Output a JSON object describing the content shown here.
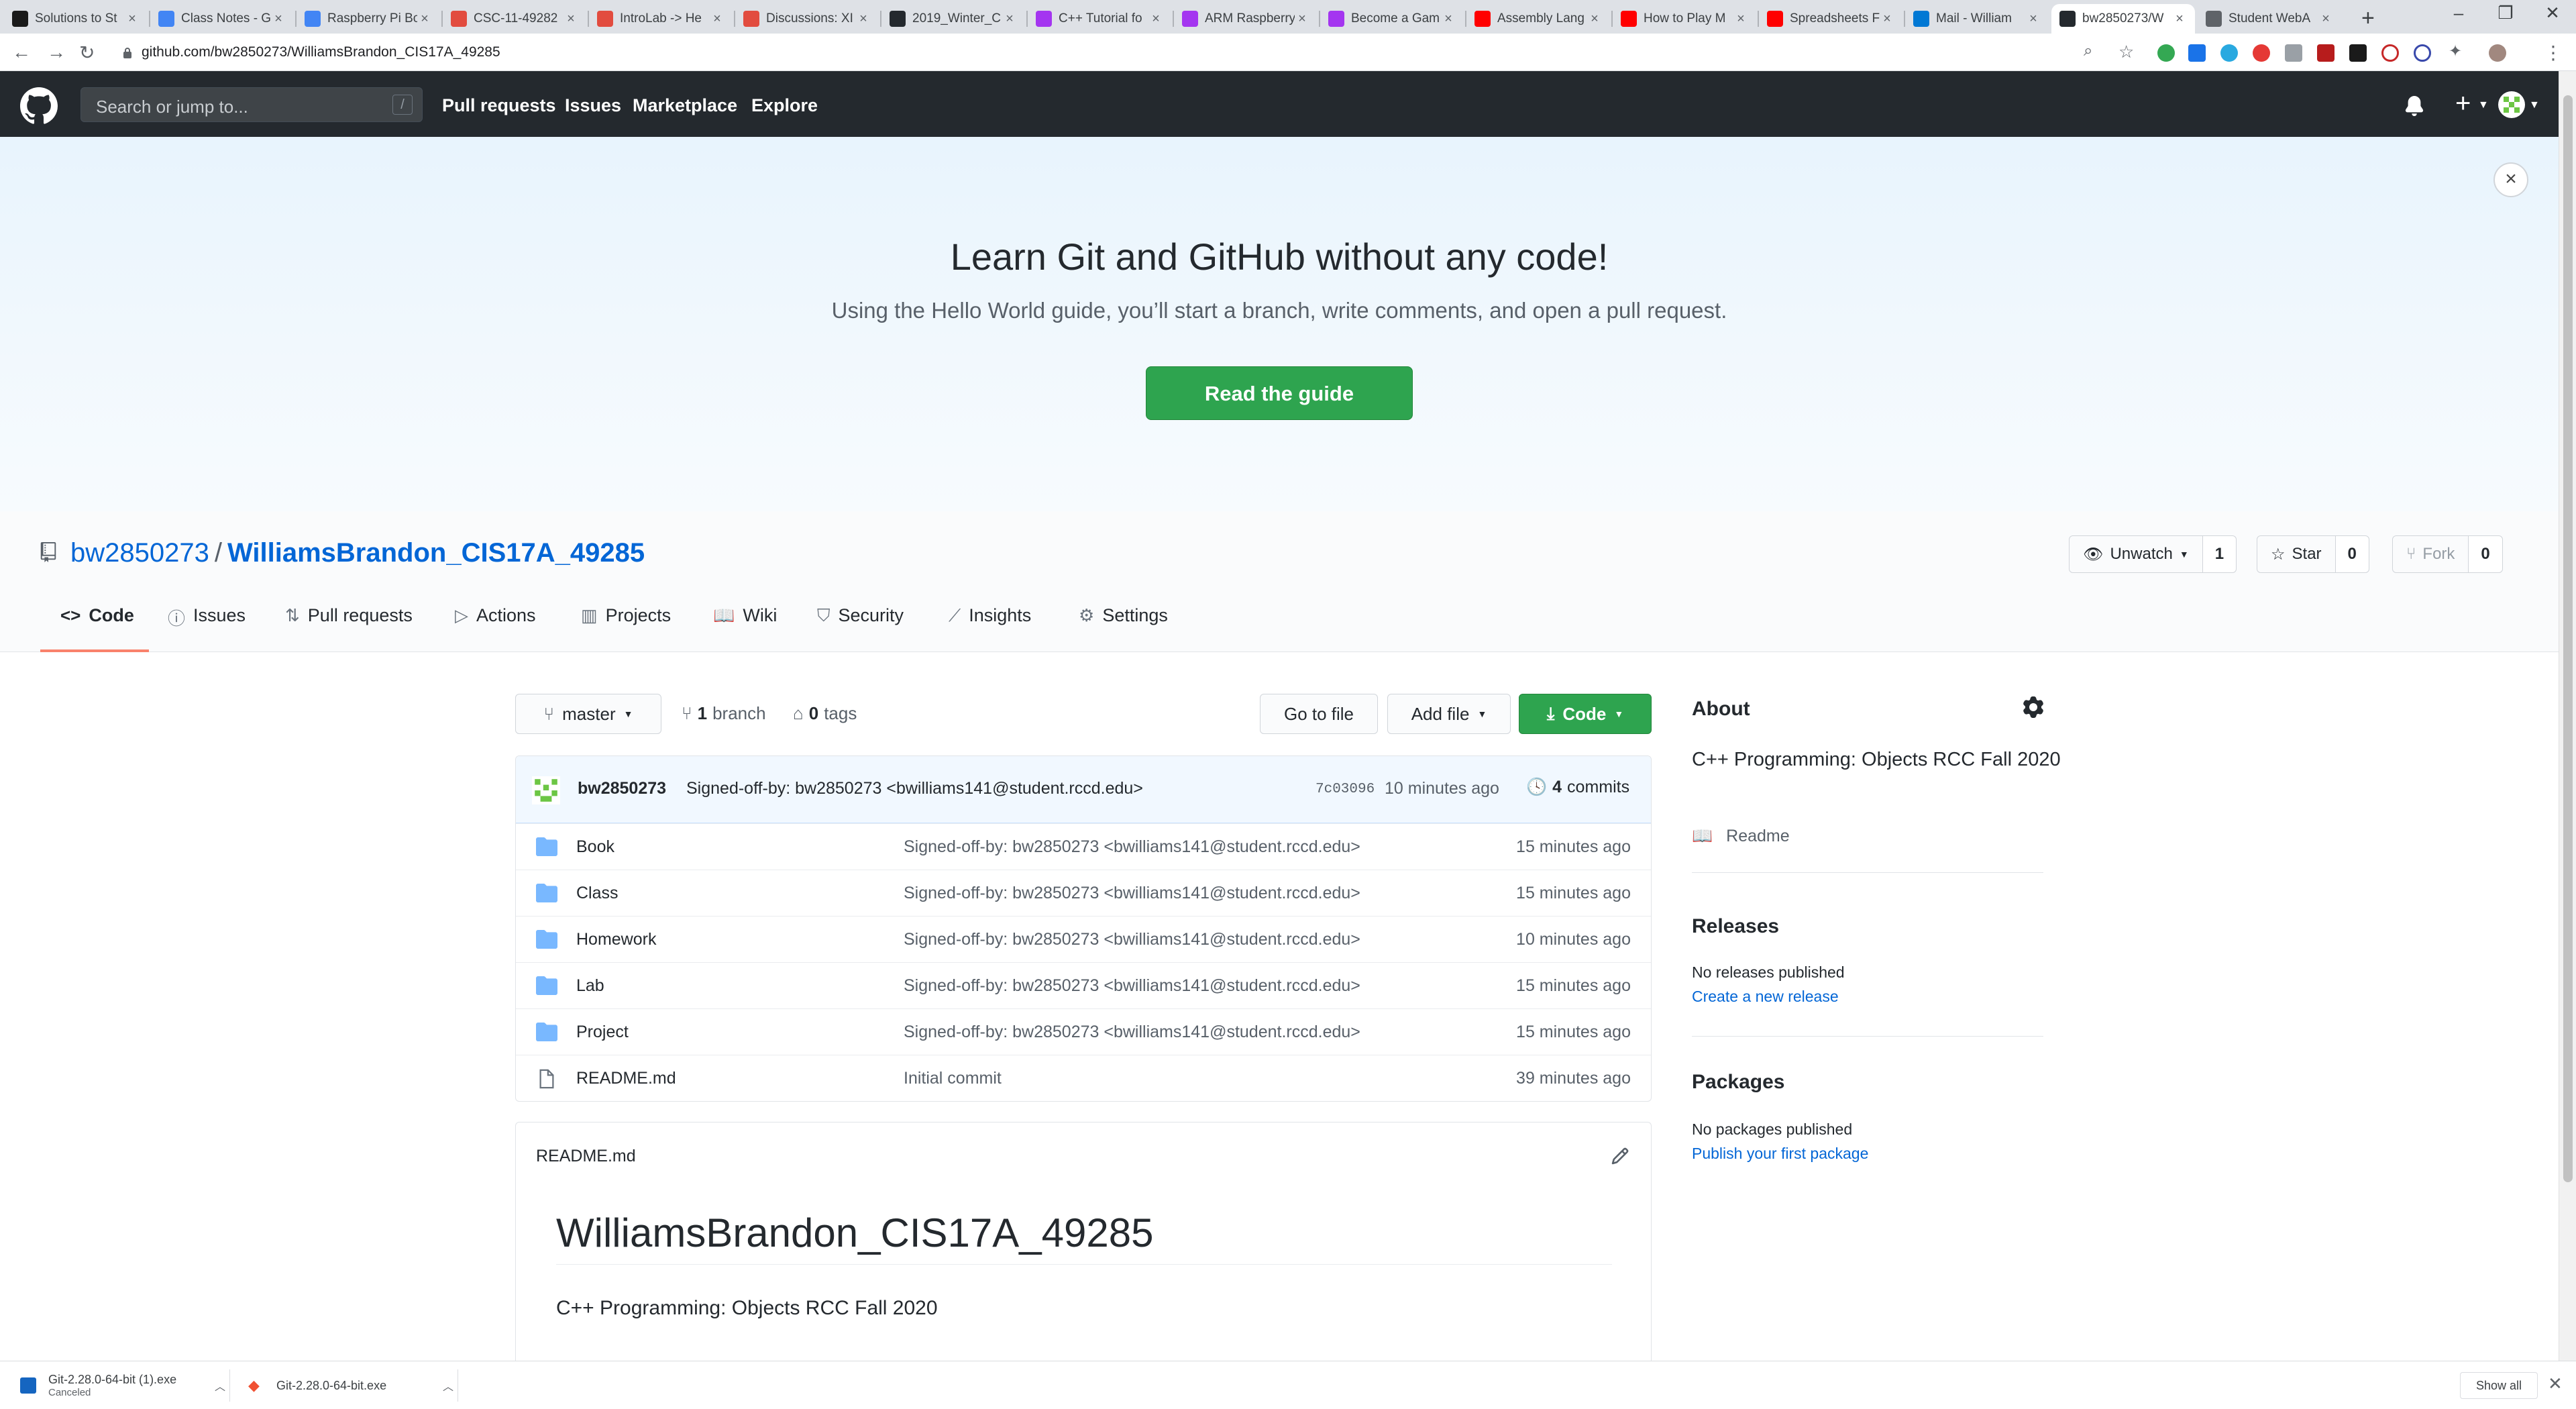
{
  "browser": {
    "tabs": [
      {
        "label": "Solutions to St",
        "icon": "book-s-icon",
        "color": "#1a1a1a"
      },
      {
        "label": "Class Notes - G",
        "icon": "docs-icon",
        "color": "#4285f4"
      },
      {
        "label": "Raspberry Pi Bo",
        "icon": "docs-icon",
        "color": "#4285f4"
      },
      {
        "label": "CSC-11-49282",
        "icon": "canvas-icon",
        "color": "#e24c3f"
      },
      {
        "label": "IntroLab -> He",
        "icon": "canvas-icon",
        "color": "#e24c3f"
      },
      {
        "label": "Discussions: XI",
        "icon": "canvas-icon",
        "color": "#e24c3f"
      },
      {
        "label": "2019_Winter_C",
        "icon": "github-icon",
        "color": "#24292e"
      },
      {
        "label": "C++ Tutorial fo",
        "icon": "udemy-icon",
        "color": "#a435f0"
      },
      {
        "label": "ARM Raspberry",
        "icon": "udemy-icon",
        "color": "#a435f0"
      },
      {
        "label": "Become a Gam",
        "icon": "udemy-icon",
        "color": "#a435f0"
      },
      {
        "label": "Assembly Lang",
        "icon": "youtube-icon",
        "color": "#ff0000"
      },
      {
        "label": "How to Play M",
        "icon": "youtube-icon",
        "color": "#ff0000"
      },
      {
        "label": "Spreadsheets F",
        "icon": "youtube-icon",
        "color": "#ff0000"
      },
      {
        "label": "Mail - William",
        "icon": "outlook-icon",
        "color": "#0078d4"
      },
      {
        "label": "bw2850273/W",
        "icon": "github-icon",
        "color": "#24292e",
        "active": true
      },
      {
        "label": "Student WebA",
        "icon": "globe-icon",
        "color": "#5f6368"
      }
    ],
    "url": "github.com/bw2850273/WilliamsBrandon_CIS17A_49285"
  },
  "gh": {
    "search_placeholder": "Search or jump to...",
    "search_key": "/",
    "nav": [
      "Pull requests",
      "Issues",
      "Marketplace",
      "Explore"
    ]
  },
  "banner": {
    "title": "Learn Git and GitHub without any code!",
    "subtitle": "Using the Hello World guide, you’ll start a branch, write comments, and open a pull request.",
    "button": "Read the guide",
    "close": "×"
  },
  "repo": {
    "owner": "bw2850273",
    "separator": "/",
    "name": "WilliamsBrandon_CIS17A_49285",
    "watch_label": "Unwatch",
    "watch_count": "1",
    "star_label": "Star",
    "star_count": "0",
    "fork_label": "Fork",
    "fork_count": "0",
    "tabs": [
      "Code",
      "Issues",
      "Pull requests",
      "Actions",
      "Projects",
      "Wiki",
      "Security",
      "Insights",
      "Settings"
    ]
  },
  "code": {
    "branch": "master",
    "branch_count": "1",
    "branch_word": "branch",
    "tag_count": "0",
    "tag_word": "tags",
    "goto": "Go to file",
    "addfile": "Add file",
    "code_btn": "Code"
  },
  "commit": {
    "user": "bw2850273",
    "message": "Signed-off-by: bw2850273 <bwilliams141@student.rccd.edu>",
    "sha": "7c03096",
    "time": "10 minutes ago",
    "count": "4",
    "count_word": "commits"
  },
  "files": [
    {
      "name": "Book",
      "type": "folder",
      "msg": "Signed-off-by: bw2850273 <bwilliams141@student.rccd.edu>",
      "time": "15 minutes ago"
    },
    {
      "name": "Class",
      "type": "folder",
      "msg": "Signed-off-by: bw2850273 <bwilliams141@student.rccd.edu>",
      "time": "15 minutes ago"
    },
    {
      "name": "Homework",
      "type": "folder",
      "msg": "Signed-off-by: bw2850273 <bwilliams141@student.rccd.edu>",
      "time": "10 minutes ago"
    },
    {
      "name": "Lab",
      "type": "folder",
      "msg": "Signed-off-by: bw2850273 <bwilliams141@student.rccd.edu>",
      "time": "15 minutes ago"
    },
    {
      "name": "Project",
      "type": "folder",
      "msg": "Signed-off-by: bw2850273 <bwilliams141@student.rccd.edu>",
      "time": "15 minutes ago"
    },
    {
      "name": "README.md",
      "type": "file",
      "msg": "Initial commit",
      "time": "39 minutes ago"
    }
  ],
  "readme": {
    "filename": "README.md",
    "heading": "WilliamsBrandon_CIS17A_49285",
    "body": "C++ Programming: Objects RCC Fall 2020"
  },
  "about": {
    "title": "About",
    "description": "C++ Programming: Objects RCC Fall 2020",
    "readme_link": "Readme",
    "releases_title": "Releases",
    "releases_text": "No releases published",
    "releases_link": "Create a new release",
    "packages_title": "Packages",
    "packages_text": "No packages published",
    "packages_link": "Publish your first package"
  },
  "downloads": [
    {
      "name": "Git-2.28.0-64-bit (1).exe",
      "status": "Canceled"
    },
    {
      "name": "Git-2.28.0-64-bit.exe",
      "status": ""
    }
  ],
  "show_all": "Show all",
  "colors": {
    "accent_green": "#2ea44f",
    "link_blue": "#0366d6",
    "header_dark": "#24292e",
    "tab_underline": "#f9826c"
  }
}
